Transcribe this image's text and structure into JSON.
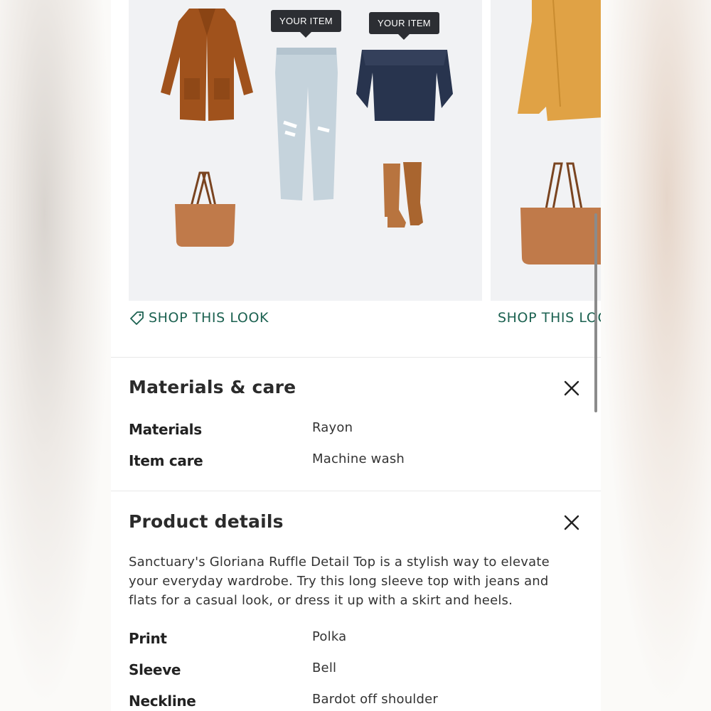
{
  "colors": {
    "accent": "#1b6150",
    "tooltip_bg": "#2c2e33",
    "card_bg": "#f1f2f4"
  },
  "looks": [
    {
      "tooltips": [
        "YOUR ITEM",
        "YOUR ITEM"
      ],
      "shop_label": "SHOP THIS LOOK",
      "icon": "tag-icon"
    },
    {
      "shop_label": "SHOP THIS LOOK",
      "icon": "tag-icon"
    }
  ],
  "materials_care": {
    "title": "Materials & care",
    "close_icon": "close-icon",
    "rows": [
      {
        "label": "Materials",
        "value": "Rayon"
      },
      {
        "label": "Item care",
        "value": "Machine wash"
      }
    ]
  },
  "product_details": {
    "title": "Product details",
    "close_icon": "close-icon",
    "description": "Sanctuary's Gloriana Ruffle Detail Top is a stylish way to elevate your everyday wardrobe. Try this long sleeve top with jeans and flats for a casual look, or dress it up with a skirt and heels.",
    "rows": [
      {
        "label": "Print",
        "value": "Polka"
      },
      {
        "label": "Sleeve",
        "value": "Bell"
      },
      {
        "label": "Neckline",
        "value": "Bardot off shoulder"
      }
    ]
  }
}
